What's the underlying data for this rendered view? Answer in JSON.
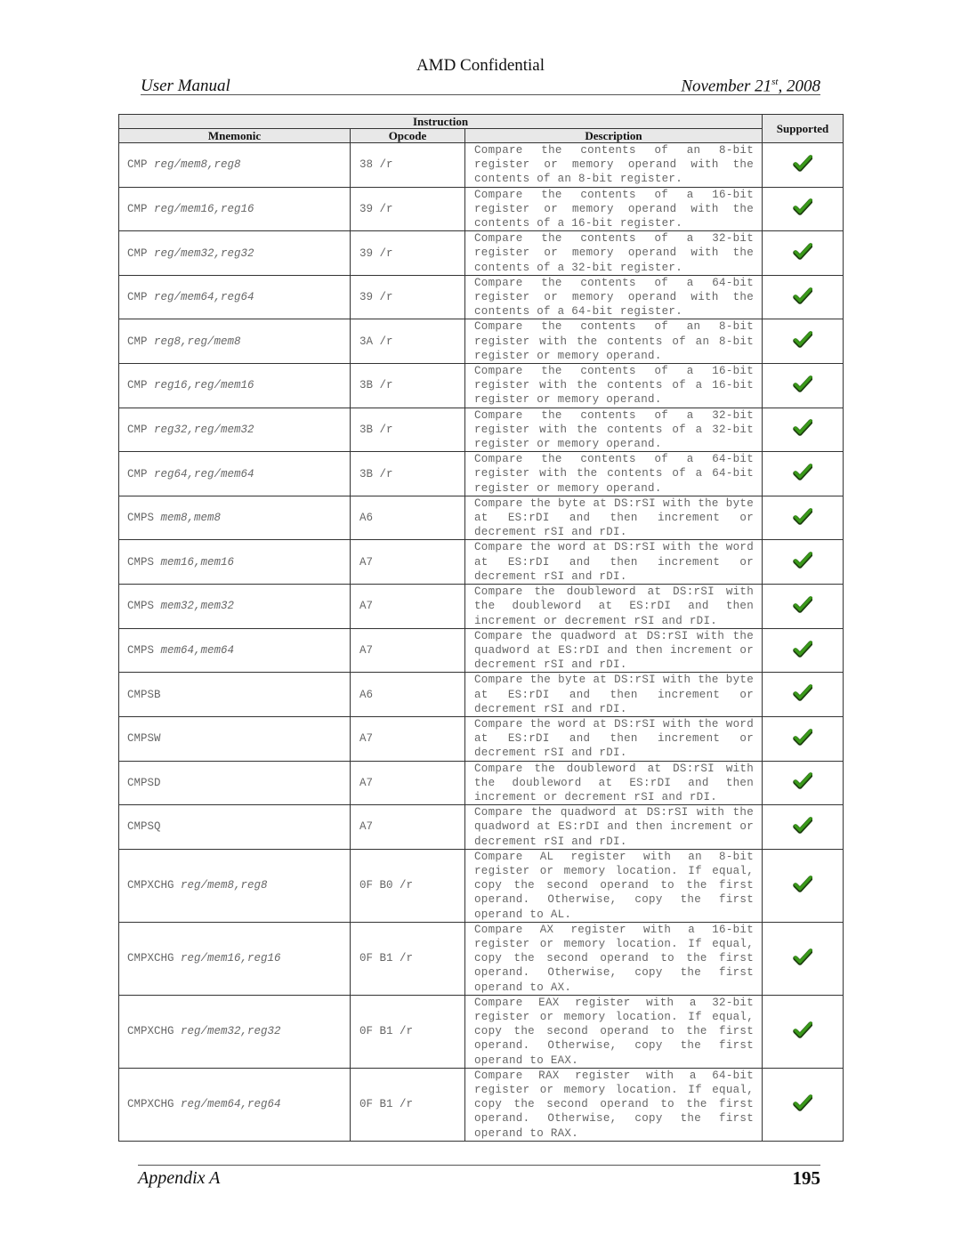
{
  "page": {
    "confidential": "AMD Confidential",
    "header_left": "User Manual",
    "header_date_prefix": "November 21",
    "header_date_sup": "st",
    "header_date_suffix": ", 2008",
    "footer_left": "Appendix A",
    "page_number": "195"
  },
  "table": {
    "group_header": "Instruction",
    "headers": {
      "mnemonic": "Mnemonic",
      "opcode": "Opcode",
      "description": "Description",
      "supported": "Supported"
    },
    "check_icon": "green-checkmark-icon",
    "check_color": "#3a9a1a",
    "rows": [
      {
        "mnemonic": "CMP",
        "operands": "reg/mem8,reg8",
        "opcode": "38 /r",
        "description": "Compare the contents of an 8-bit register or memory operand with the contents of an 8-bit register.",
        "supported": true
      },
      {
        "mnemonic": "CMP",
        "operands": "reg/mem16,reg16",
        "opcode": "39 /r",
        "description": "Compare the contents of a 16-bit register or memory operand with the contents of a 16-bit register.",
        "supported": true
      },
      {
        "mnemonic": "CMP",
        "operands": "reg/mem32,reg32",
        "opcode": "39 /r",
        "description": "Compare the contents of a 32-bit register or memory operand with the contents of a 32-bit register.",
        "supported": true
      },
      {
        "mnemonic": "CMP",
        "operands": "reg/mem64,reg64",
        "opcode": "39 /r",
        "description": "Compare the contents of a 64-bit register or memory operand with the contents of a 64-bit register.",
        "supported": true
      },
      {
        "mnemonic": "CMP",
        "operands": "reg8,reg/mem8",
        "opcode": "3A /r",
        "description": "Compare the contents of an 8-bit register with the contents of an 8-bit register or memory operand.",
        "supported": true
      },
      {
        "mnemonic": "CMP",
        "operands": "reg16,reg/mem16",
        "opcode": "3B /r",
        "description": "Compare the contents of a 16-bit register with the contents of a 16-bit register or memory operand.",
        "supported": true
      },
      {
        "mnemonic": "CMP",
        "operands": "reg32,reg/mem32",
        "opcode": "3B /r",
        "description": "Compare the contents of a 32-bit register with the contents of a 32-bit register or memory operand.",
        "supported": true
      },
      {
        "mnemonic": "CMP",
        "operands": "reg64,reg/mem64",
        "opcode": "3B /r",
        "description": "Compare the contents of a 64-bit register with the contents of a 64-bit register or memory operand.",
        "supported": true
      },
      {
        "mnemonic": "CMPS",
        "operands": "mem8,mem8",
        "opcode": "A6",
        "description": "Compare the byte at DS:rSI with the byte at ES:rDI and then increment or decrement rSI and rDI.",
        "supported": true
      },
      {
        "mnemonic": "CMPS",
        "operands": "mem16,mem16",
        "opcode": "A7",
        "description": "Compare the word at DS:rSI with the word at ES:rDI and then increment or decrement rSI and rDI.",
        "supported": true
      },
      {
        "mnemonic": "CMPS",
        "operands": "mem32,mem32",
        "opcode": "A7",
        "description": "Compare the doubleword at DS:rSI with the doubleword at ES:rDI and then increment or decrement rSI and rDI.",
        "supported": true
      },
      {
        "mnemonic": "CMPS",
        "operands": "mem64,mem64",
        "opcode": "A7",
        "description": "Compare the quadword at DS:rSI with the quadword at ES:rDI and then increment or decrement rSI and rDI.",
        "supported": true
      },
      {
        "mnemonic": "CMPSB",
        "operands": "",
        "opcode": "A6",
        "description": "Compare the byte at DS:rSI with the byte at ES:rDI and then increment or decrement rSI and rDI.",
        "supported": true
      },
      {
        "mnemonic": "CMPSW",
        "operands": "",
        "opcode": "A7",
        "description": "Compare the word at DS:rSI with the word at ES:rDI and then increment or decrement rSI and rDI.",
        "supported": true
      },
      {
        "mnemonic": "CMPSD",
        "operands": "",
        "opcode": "A7",
        "description": "Compare the doubleword at DS:rSI with the doubleword at ES:rDI and then increment or decrement rSI and rDI.",
        "supported": true
      },
      {
        "mnemonic": "CMPSQ",
        "operands": "",
        "opcode": "A7",
        "description": "Compare the quadword at DS:rSI with the quadword at ES:rDI and then increment or decrement rSI and rDI.",
        "supported": true
      },
      {
        "mnemonic": "CMPXCHG",
        "operands": "reg/mem8,reg8",
        "opcode": "0F B0 /r",
        "description": "Compare AL register with an 8-bit register or memory location. If equal, copy the second operand to the first operand. Otherwise, copy the first operand to AL.",
        "supported": true
      },
      {
        "mnemonic": "CMPXCHG",
        "operands": "reg/mem16,reg16",
        "opcode": "0F B1 /r",
        "description": "Compare AX register with a 16-bit register or memory location. If equal, copy the second operand to the first operand. Otherwise, copy the first operand to AX.",
        "supported": true
      },
      {
        "mnemonic": "CMPXCHG",
        "operands": "reg/mem32,reg32",
        "opcode": "0F B1 /r",
        "description": "Compare EAX register with a 32-bit register or memory location. If equal, copy the second operand to the first operand. Otherwise, copy the first operand to EAX.",
        "supported": true
      },
      {
        "mnemonic": "CMPXCHG",
        "operands": "reg/mem64,reg64",
        "opcode": "0F B1 /r",
        "description": "Compare RAX register with a 64-bit register or memory location. If equal, copy the second operand to the first operand. Otherwise, copy the first operand to RAX.",
        "supported": true
      }
    ]
  }
}
